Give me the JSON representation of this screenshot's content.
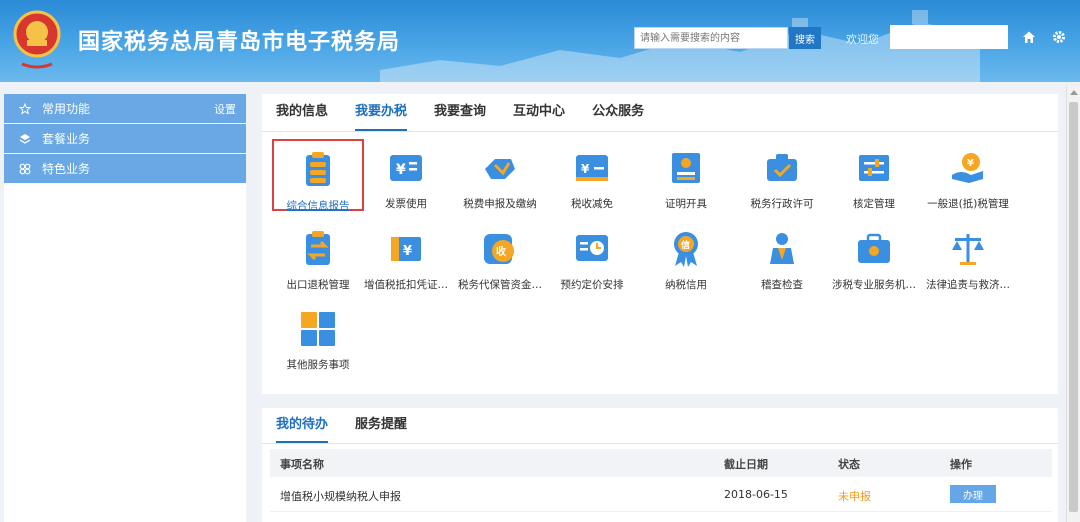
{
  "header": {
    "title": "国家税务总局青岛市电子税务局",
    "search_placeholder": "请输入需要搜索的内容",
    "search_button": "搜索",
    "welcome": "欢迎您"
  },
  "sidebar": {
    "items": [
      {
        "label": "常用功能",
        "right": "设置",
        "icon": "star-icon"
      },
      {
        "label": "套餐业务",
        "icon": "layers-icon"
      },
      {
        "label": "特色业务",
        "icon": "grid-icon"
      }
    ]
  },
  "main": {
    "tabs": [
      "我的信息",
      "我要办税",
      "我要查询",
      "互动中心",
      "公众服务"
    ],
    "active_tab": "我要办税",
    "services": [
      {
        "label": "综合信息报告",
        "icon": "report-icon"
      },
      {
        "label": "发票使用",
        "icon": "invoice-icon"
      },
      {
        "label": "税费申报及缴纳",
        "icon": "declare-icon"
      },
      {
        "label": "税收减免",
        "icon": "reduction-icon"
      },
      {
        "label": "证明开具",
        "icon": "certificate-icon"
      },
      {
        "label": "税务行政许可",
        "icon": "license-icon"
      },
      {
        "label": "核定管理",
        "icon": "settings-sliders-icon"
      },
      {
        "label": "一般退(抵)税管理",
        "icon": "refund-icon"
      },
      {
        "label": "出口退税管理",
        "icon": "export-refund-icon"
      },
      {
        "label": "增值税抵扣凭证…",
        "icon": "vat-voucher-icon"
      },
      {
        "label": "税务代保管资金…",
        "icon": "custody-fund-icon"
      },
      {
        "label": "预约定价安排",
        "icon": "pricing-icon"
      },
      {
        "label": "纳税信用",
        "icon": "credit-medal-icon"
      },
      {
        "label": "稽查检查",
        "icon": "inspection-icon"
      },
      {
        "label": "涉税专业服务机…",
        "icon": "agency-briefcase-icon"
      },
      {
        "label": "法律追责与救济…",
        "icon": "scales-icon"
      },
      {
        "label": "其他服务事项",
        "icon": "other-tiles-icon"
      }
    ]
  },
  "todo": {
    "tabs": [
      "我的待办",
      "服务提醒"
    ],
    "columns": [
      "事项名称",
      "截止日期",
      "状态",
      "操作"
    ],
    "rows": [
      {
        "name": "增值税小规模纳税人申报",
        "deadline": "2018-06-15",
        "status": "未申报",
        "action": "办理"
      }
    ]
  },
  "colors": {
    "brand_blue": "#1f6fbf",
    "header_blue": "#2a8ad6",
    "sidebar_blue": "#69a8e4",
    "icon_blue": "#3b8fe0",
    "icon_orange": "#f5a623",
    "status_orange": "#f39c1f",
    "highlight_red": "#e14040"
  }
}
